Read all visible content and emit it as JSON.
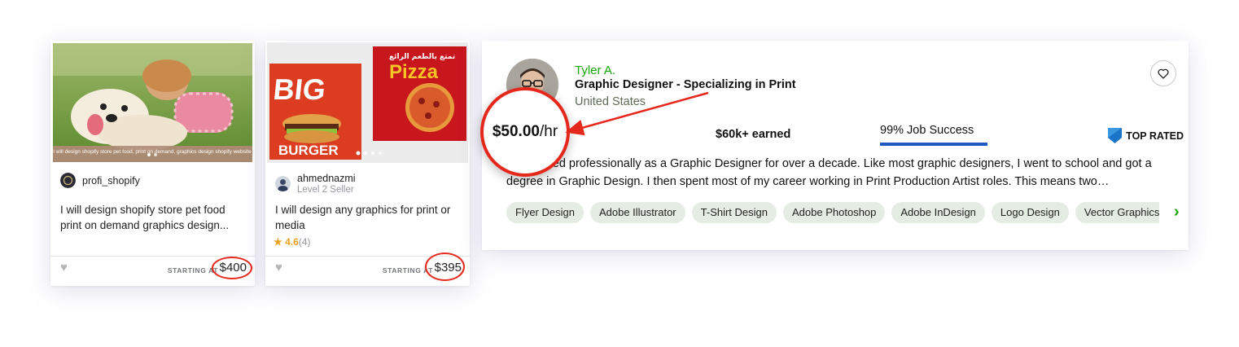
{
  "gigs": [
    {
      "seller_name": "profi_shopify",
      "seller_level": "",
      "title": "I will design shopify store pet food print on demand graphics design...",
      "thumb_caption": "I will design shopify store pet food, print on demand, graphics design shopify website",
      "rating": "",
      "rating_count": "",
      "starting_label": "STARTING AT",
      "price": "$400"
    },
    {
      "seller_name": "ahmednazmi",
      "seller_level": "Level 2 Seller",
      "title": "I will design any graphics for print or media",
      "thumb_big": "BIG",
      "thumb_burger": "BURGER",
      "thumb_pizza": "Pizza",
      "rating": "4.6",
      "rating_count": "(4)",
      "starting_label": "STARTING AT",
      "price": "$395"
    }
  ],
  "profile": {
    "name": "Tyler A.",
    "title": "Graphic Designer - Specializing in Print",
    "location": "United States",
    "rate": "$50.00",
    "rate_unit": "/hr",
    "earned": "$60k+ earned",
    "job_success": "99% Job Success",
    "badge": "TOP RATED",
    "bio": "I've worked professionally as a Graphic Designer for over a decade. Like most graphic designers, I went to school and got a degree in Graphic Design. I then spent most of my career working in Print Production Artist roles. This means two…",
    "skills": [
      "Flyer Design",
      "Adobe Illustrator",
      "T-Shirt Design",
      "Adobe Photoshop",
      "Adobe InDesign",
      "Logo Design",
      "Vector Graphics"
    ]
  },
  "colors": {
    "annotation": "#e5281c",
    "upwork_green": "#14a800",
    "job_success_bar": "#1f57c3"
  },
  "icons": {
    "heart": "heart-icon",
    "favorite": "heart-outline-icon",
    "top_rated": "top-rated-badge-icon",
    "next": "chevron-right-icon",
    "star": "star-icon"
  }
}
